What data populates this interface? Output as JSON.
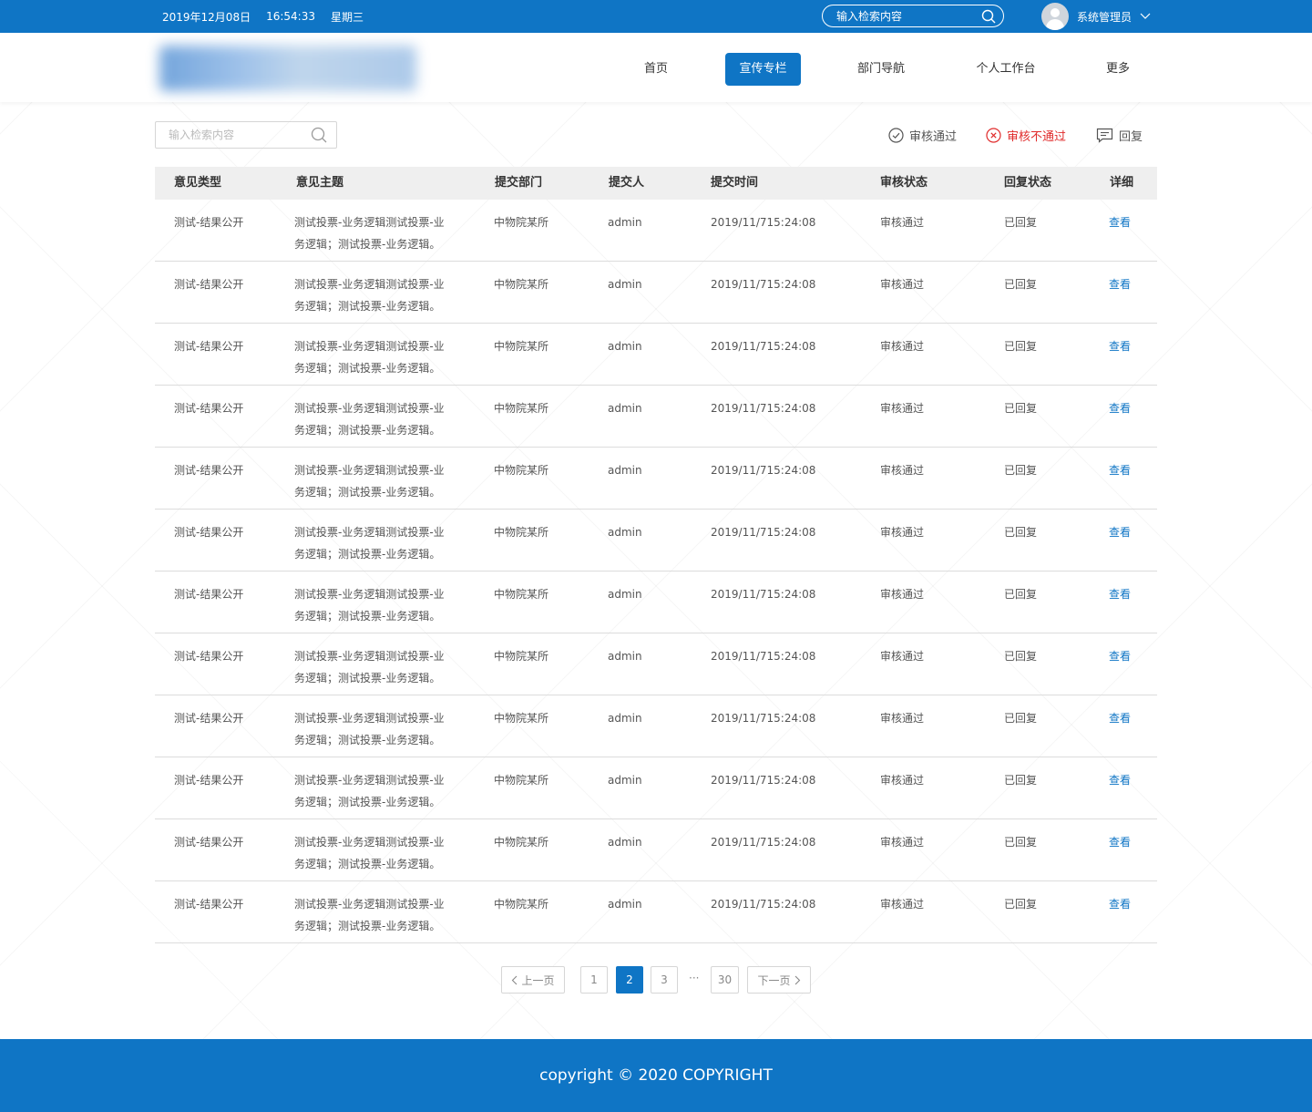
{
  "topbar": {
    "date": "2019年12月08日",
    "time": "16:54:33",
    "weekday": "星期三",
    "search_placeholder": "输入检索内容",
    "user_name": "系统管理员"
  },
  "nav": {
    "items": [
      {
        "label": "首页",
        "active": false
      },
      {
        "label": "宣传专栏",
        "active": true
      },
      {
        "label": "部门导航",
        "active": false
      },
      {
        "label": "个人工作台",
        "active": false
      },
      {
        "label": "更多",
        "active": false
      }
    ]
  },
  "toolbar": {
    "search_placeholder": "输入检索内容",
    "approve_label": "审核通过",
    "reject_label": "审核不通过",
    "reply_label": "回复"
  },
  "table": {
    "headers": [
      "意见类型",
      "意见主题",
      "提交部门",
      "提交人",
      "提交时间",
      "审核状态",
      "回复状态",
      "详细"
    ],
    "rows": [
      {
        "type": "测试-结果公开",
        "topic_1": "测试投票-业务逻辑测试投票-业",
        "topic_2": "务逻辑；测试投票-业务逻辑。",
        "dept": "中物院某所",
        "submitter": "admin",
        "time": "2019/11/715:24:08",
        "audit": "审核通过",
        "reply": "已回复",
        "detail": "查看"
      },
      {
        "type": "测试-结果公开",
        "topic_1": "测试投票-业务逻辑测试投票-业",
        "topic_2": "务逻辑；测试投票-业务逻辑。",
        "dept": "中物院某所",
        "submitter": "admin",
        "time": "2019/11/715:24:08",
        "audit": "审核通过",
        "reply": "已回复",
        "detail": "查看"
      },
      {
        "type": "测试-结果公开",
        "topic_1": "测试投票-业务逻辑测试投票-业",
        "topic_2": "务逻辑；测试投票-业务逻辑。",
        "dept": "中物院某所",
        "submitter": "admin",
        "time": "2019/11/715:24:08",
        "audit": "审核通过",
        "reply": "已回复",
        "detail": "查看"
      },
      {
        "type": "测试-结果公开",
        "topic_1": "测试投票-业务逻辑测试投票-业",
        "topic_2": "务逻辑；测试投票-业务逻辑。",
        "dept": "中物院某所",
        "submitter": "admin",
        "time": "2019/11/715:24:08",
        "audit": "审核通过",
        "reply": "已回复",
        "detail": "查看"
      },
      {
        "type": "测试-结果公开",
        "topic_1": "测试投票-业务逻辑测试投票-业",
        "topic_2": "务逻辑；测试投票-业务逻辑。",
        "dept": "中物院某所",
        "submitter": "admin",
        "time": "2019/11/715:24:08",
        "audit": "审核通过",
        "reply": "已回复",
        "detail": "查看"
      },
      {
        "type": "测试-结果公开",
        "topic_1": "测试投票-业务逻辑测试投票-业",
        "topic_2": "务逻辑；测试投票-业务逻辑。",
        "dept": "中物院某所",
        "submitter": "admin",
        "time": "2019/11/715:24:08",
        "audit": "审核通过",
        "reply": "已回复",
        "detail": "查看"
      },
      {
        "type": "测试-结果公开",
        "topic_1": "测试投票-业务逻辑测试投票-业",
        "topic_2": "务逻辑；测试投票-业务逻辑。",
        "dept": "中物院某所",
        "submitter": "admin",
        "time": "2019/11/715:24:08",
        "audit": "审核通过",
        "reply": "已回复",
        "detail": "查看"
      },
      {
        "type": "测试-结果公开",
        "topic_1": "测试投票-业务逻辑测试投票-业",
        "topic_2": "务逻辑；测试投票-业务逻辑。",
        "dept": "中物院某所",
        "submitter": "admin",
        "time": "2019/11/715:24:08",
        "audit": "审核通过",
        "reply": "已回复",
        "detail": "查看"
      },
      {
        "type": "测试-结果公开",
        "topic_1": "测试投票-业务逻辑测试投票-业",
        "topic_2": "务逻辑；测试投票-业务逻辑。",
        "dept": "中物院某所",
        "submitter": "admin",
        "time": "2019/11/715:24:08",
        "audit": "审核通过",
        "reply": "已回复",
        "detail": "查看"
      },
      {
        "type": "测试-结果公开",
        "topic_1": "测试投票-业务逻辑测试投票-业",
        "topic_2": "务逻辑；测试投票-业务逻辑。",
        "dept": "中物院某所",
        "submitter": "admin",
        "time": "2019/11/715:24:08",
        "audit": "审核通过",
        "reply": "已回复",
        "detail": "查看"
      },
      {
        "type": "测试-结果公开",
        "topic_1": "测试投票-业务逻辑测试投票-业",
        "topic_2": "务逻辑；测试投票-业务逻辑。",
        "dept": "中物院某所",
        "submitter": "admin",
        "time": "2019/11/715:24:08",
        "audit": "审核通过",
        "reply": "已回复",
        "detail": "查看"
      },
      {
        "type": "测试-结果公开",
        "topic_1": "测试投票-业务逻辑测试投票-业",
        "topic_2": "务逻辑；测试投票-业务逻辑。",
        "dept": "中物院某所",
        "submitter": "admin",
        "time": "2019/11/715:24:08",
        "audit": "审核通过",
        "reply": "已回复",
        "detail": "查看"
      }
    ]
  },
  "pagination": {
    "prev_label": "上一页",
    "next_label": "下一页",
    "pages": [
      "1",
      "2",
      "3"
    ],
    "current": "2",
    "ellipsis": "···",
    "last": "30"
  },
  "footer": {
    "text": "copyright © 2020 COPYRIGHT"
  },
  "colors": {
    "brand": "#0f75c5",
    "reject": "#e02b2b",
    "link": "#0f75c5"
  }
}
